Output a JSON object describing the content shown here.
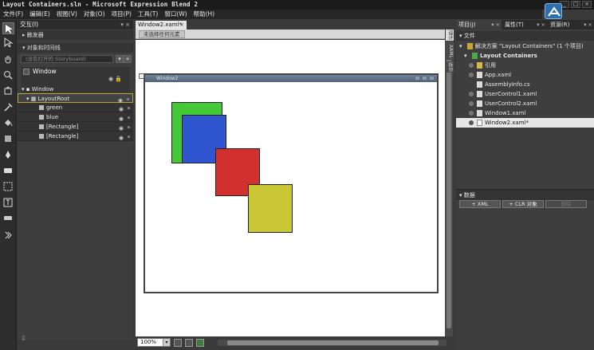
{
  "window": {
    "title": "Layout Containers.sln - Microsoft Expression Blend 2",
    "min": "_",
    "max": "□",
    "close": "×"
  },
  "menu": [
    "文件(F)",
    "编辑(E)",
    "视图(V)",
    "对象(O)",
    "项目(P)",
    "工具(T)",
    "窗口(W)",
    "帮助(H)"
  ],
  "left_panel": {
    "header": "交互(I)",
    "triggers": "触发器",
    "objects_timeline": "对象和时间线",
    "storyboard_placeholder": "(没有打开的 Storyboard)",
    "storyboard_add": "+",
    "storyboard_menu": "▾",
    "scope_label": "Window",
    "tree": [
      {
        "label": "Window",
        "level": 0
      },
      {
        "label": "LayoutRoot",
        "level": 1
      },
      {
        "label": "green",
        "level": 2
      },
      {
        "label": "blue",
        "level": 2
      },
      {
        "label": "[Rectangle]",
        "level": 2
      },
      {
        "label": "[Rectangle]",
        "level": 2
      }
    ]
  },
  "document": {
    "tab_label": "Window2.xaml*",
    "tab_close": "×",
    "breadcrumb": "未选择任何元素",
    "window_title": "Window2",
    "side_tabs": [
      "设计",
      "XAML",
      "拆分"
    ]
  },
  "rectangles": [
    {
      "name": "green",
      "color": "#44c838"
    },
    {
      "name": "blue",
      "color": "#2f55cf"
    },
    {
      "name": "red",
      "color": "#d2302e"
    },
    {
      "name": "yellow",
      "color": "#c9c834"
    }
  ],
  "bottom": {
    "zoom": "100%"
  },
  "right_panel": {
    "tabs": [
      "项目(J)",
      "属性(T)",
      "资源(R)"
    ],
    "files_header": "文件",
    "solution": "解决方案 \"Layout Containers\" (1 个项目)",
    "project": "Layout Containers",
    "items": [
      "引用",
      "App.xaml",
      "AssemblyInfo.cs",
      "UserControl1.xaml",
      "UserControl2.xaml",
      "Window1.xaml",
      "Window2.xaml*"
    ],
    "data_header": "数据",
    "data_buttons": [
      "+ XML",
      "+ CLR 对象",
      "删除"
    ]
  }
}
